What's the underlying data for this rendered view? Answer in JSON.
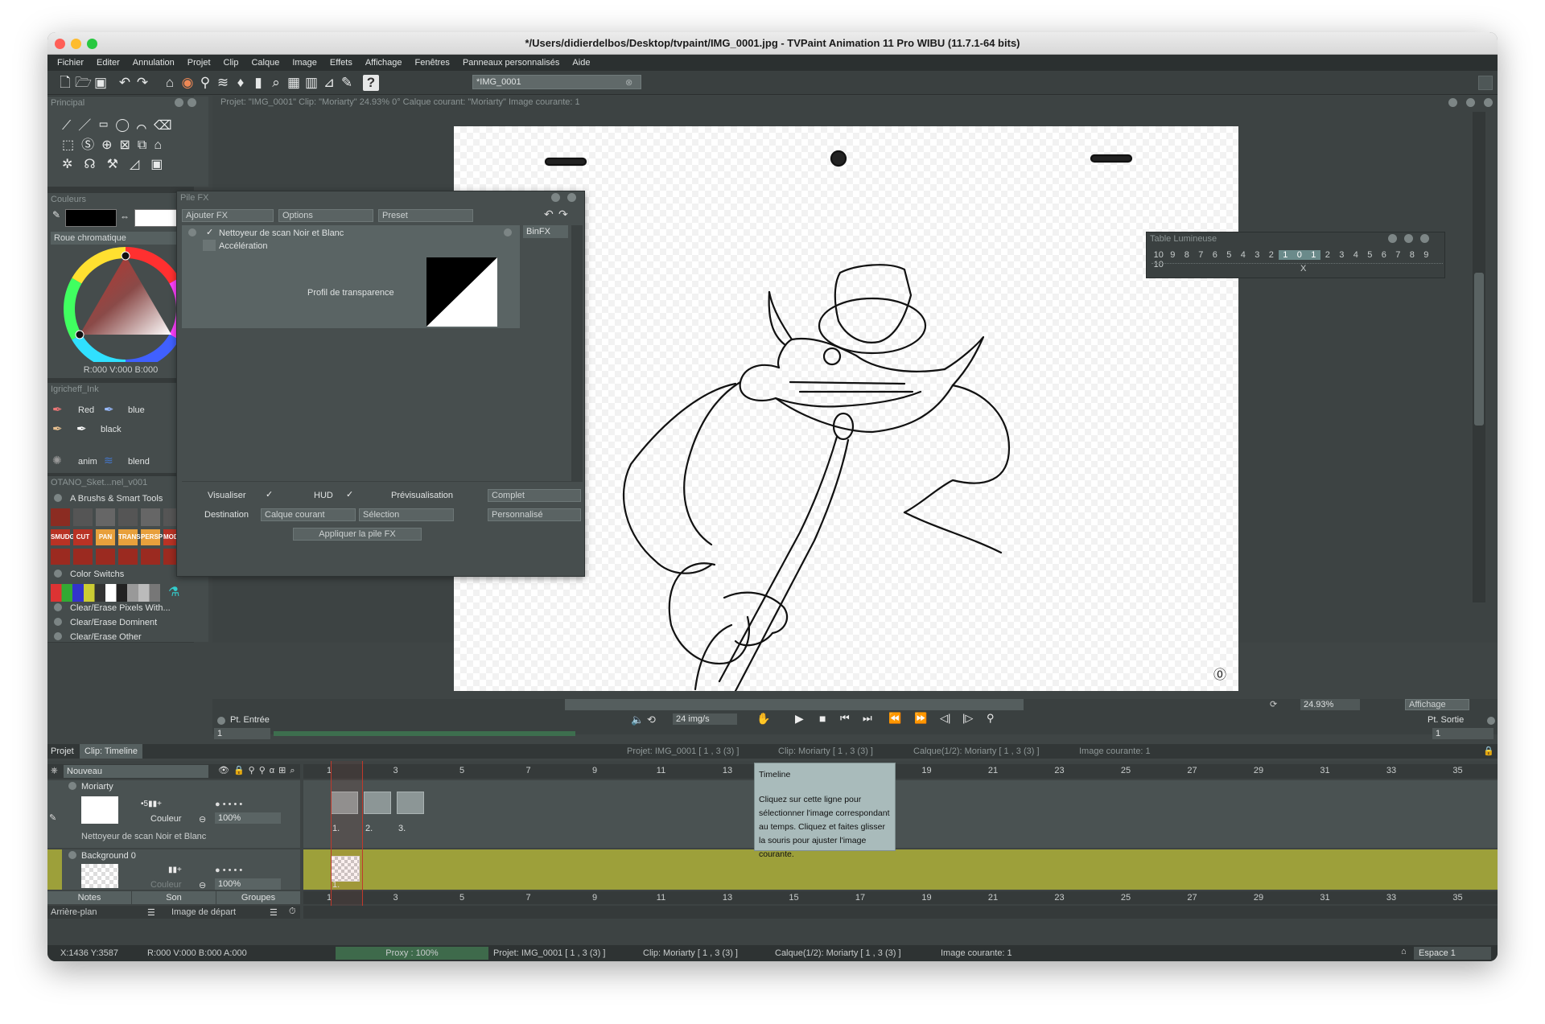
{
  "window": {
    "title": "*/Users/didierdelbos/Desktop/tvpaint/IMG_0001.jpg - TVPaint Animation 11 Pro WIBU (11.7.1-64 bits)"
  },
  "menu": [
    "Fichier",
    "Editer",
    "Annulation",
    "Projet",
    "Clip",
    "Calque",
    "Image",
    "Effets",
    "Affichage",
    "Fenêtres",
    "Panneaux personnalisés",
    "Aide"
  ],
  "toolbar": {
    "project_field": "*IMG_0001"
  },
  "main_panel": {
    "title": "Principal"
  },
  "info_line": "Projet: \"IMG_0001\" Clip: \"Moriarty\" 24.93%  0°  Calque courant: \"Moriarty\"  Image courante: 1",
  "colors": {
    "title": "Couleurs",
    "wheel_label": "Roue chromatique",
    "rgb_readout": "R:000 V:000 B:000",
    "primary": "#000000",
    "secondary": "#ffffff",
    "background": "#3f4545",
    "panel": "#454c4c",
    "accent_green": "#9da03a",
    "timeline_cursor": "#c0392b"
  },
  "brush_panel": {
    "title": "Igricheff_Ink",
    "items": [
      "Red",
      "blue",
      "black",
      "anim",
      "blend"
    ]
  },
  "custom_panel": {
    "title": "OTANO_Sket...nel_v001",
    "section1": "A Brushs & Smart Tools",
    "tool_labels": [
      "SMUDGE",
      "CUT B",
      "PAN",
      "TRANS",
      "PERSP",
      "MODE"
    ],
    "section2": "Color Switchs",
    "items": [
      "Clear/Erase Pixels With...",
      "Clear/Erase Dominent",
      "Clear/Erase Other"
    ]
  },
  "fx_stack": {
    "title": "Pile FX",
    "add_fx": "Ajouter FX",
    "options": "Options",
    "preset": "Preset",
    "effect_name": "Nettoyeur de scan Noir et Blanc",
    "binfx": "BinFX",
    "acceleration": "Accélération",
    "transparency_profile": "Profil de transparence",
    "visualiser": "Visualiser",
    "hud": "HUD",
    "preview_label": "Prévisualisation",
    "preview_value": "Complet",
    "destination_label": "Destination",
    "destination_value": "Calque courant",
    "selection_value": "Sélection",
    "custom_value": "Personnalisé",
    "apply_button": "Appliquer la pile FX"
  },
  "light_table": {
    "title": "Table Lumineuse",
    "numbers": [
      "10",
      "9",
      "8",
      "7",
      "6",
      "5",
      "4",
      "3",
      "2",
      "1",
      "0",
      "1",
      "2",
      "3",
      "4",
      "5",
      "6",
      "7",
      "8",
      "9",
      "10"
    ],
    "active_indices": [
      9,
      10,
      11
    ],
    "center_mark": "X"
  },
  "playback": {
    "in_point": "Pt. Entrée",
    "out_point": "Pt. Sortie",
    "fps": "24 img/s",
    "zoom": "24.93%",
    "display": "Affichage",
    "in_value": "1",
    "out_value": "1"
  },
  "timeline": {
    "tabs": [
      "Projet",
      "Clip: Timeline"
    ],
    "status": [
      "Projet: IMG_0001 [ 1 , 3  (3) ]",
      "Clip: Moriarty [ 1 , 3  (3) ]",
      "Calque(1/2): Moriarty [ 1 , 3  (3) ]",
      "Image courante: 1"
    ],
    "new_button": "Nouveau",
    "frame_numbers": [
      "1",
      "3",
      "5",
      "7",
      "9",
      "11",
      "13",
      "15",
      "17",
      "19",
      "21",
      "23",
      "25",
      "27",
      "29",
      "31",
      "33",
      "35"
    ],
    "layers": [
      {
        "name": "Moriarty",
        "color_label": "Couleur",
        "opacity": "100%",
        "fx": "Nettoyeur de scan Noir et Blanc",
        "cells": [
          "1.",
          "2.",
          "3."
        ]
      },
      {
        "name": "Background 0",
        "color_label": "Couleur",
        "opacity": "100%",
        "cells": [
          "1."
        ]
      }
    ],
    "bottom_tabs": [
      "Notes",
      "Son",
      "Groupes"
    ],
    "background_label": "Arrière-plan",
    "start_image_label": "Image de départ",
    "tooltip": {
      "title": "Timeline",
      "body": "Cliquez sur cette ligne pour sélectionner l'image correspondant au temps. Cliquez et faites glisser la souris pour ajuster l'image courante."
    }
  },
  "statusbar": {
    "coords": "X:1436  Y:3587",
    "rgba": "R:000 V:000 B:000 A:000",
    "proxy": "Proxy : 100%",
    "project": "Projet: IMG_0001 [ 1 , 3  (3) ]",
    "clip": "Clip: Moriarty [ 1 , 3  (3) ]",
    "layer": "Calque(1/2): Moriarty [ 1 , 3  (3) ]",
    "image": "Image courante: 1",
    "workspace": "Espace 1"
  }
}
